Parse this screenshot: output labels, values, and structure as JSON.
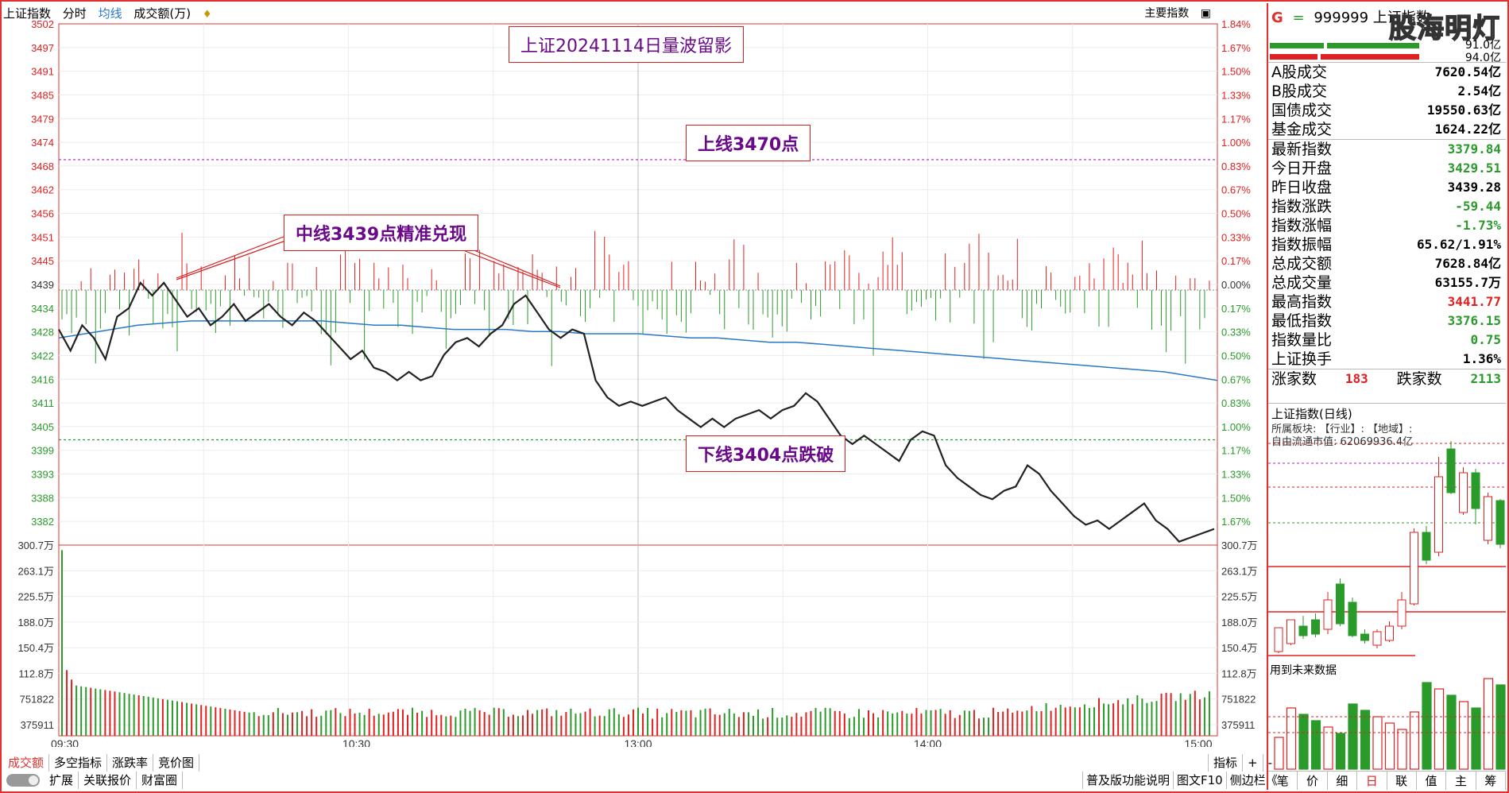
{
  "colors": {
    "up": "#e02020",
    "down": "#2a9a2a",
    "avg_line": "#2878c8",
    "index_line": "#222222",
    "frame": "#e03030",
    "annotation_text": "#6a0a8a"
  },
  "topbar": {
    "index_name": "上证指数",
    "tab_timeshare": "分时",
    "tab_avg": "均线",
    "tab_amount": "成交额(万)",
    "amount_icon": "♦",
    "main_indicator": "主要指数",
    "main_indicator_icon": "▣"
  },
  "annotations": {
    "title": "上证20241114日量波留影",
    "upper": "上线3470点",
    "middle": "中线3439点精准兑现",
    "lower": "下线3404点跌破"
  },
  "axes": {
    "price_left": [
      "3502",
      "3497",
      "3491",
      "3485",
      "3479",
      "3474",
      "3468",
      "3462",
      "3456",
      "3451",
      "3445",
      "3439",
      "3434",
      "3428",
      "3422",
      "3416",
      "3411",
      "3405",
      "3399",
      "3393",
      "3388",
      "3382"
    ],
    "pct_right": [
      "1.84%",
      "1.67%",
      "1.50%",
      "1.33%",
      "1.17%",
      "1.00%",
      "0.83%",
      "0.67%",
      "0.50%",
      "0.33%",
      "0.17%",
      "0.00%",
      "0.17%",
      "0.33%",
      "0.50%",
      "0.67%",
      "0.83%",
      "1.00%",
      "1.17%",
      "1.33%",
      "1.50%",
      "1.67%"
    ],
    "volume_labels": [
      "300.7万",
      "263.1万",
      "225.5万",
      "188.0万",
      "150.4万",
      "112.8万",
      "751822",
      "375911"
    ],
    "time_labels": [
      "09:30",
      "10:30",
      "13:00",
      "14:00",
      "15:00"
    ]
  },
  "chart_data": {
    "type": "line",
    "title": "",
    "xlabel": "",
    "ylabel": "",
    "prev_close": 3439.28,
    "ylim": [
      3379.2,
      3502
    ],
    "upper_line": 3470,
    "lower_line": 3404,
    "index_series": [
      3430,
      3425,
      3431,
      3428,
      3423,
      3433,
      3435,
      3441,
      3438,
      3441,
      3437,
      3433,
      3435,
      3431,
      3433,
      3436,
      3432,
      3434,
      3436,
      3433,
      3431,
      3434,
      3432,
      3429,
      3426,
      3423,
      3425,
      3421,
      3420,
      3418,
      3420,
      3418,
      3419,
      3424,
      3427,
      3428,
      3426,
      3429,
      3431,
      3436,
      3438,
      3434,
      3430,
      3428,
      3430,
      3429,
      3418,
      3414,
      3412,
      3413,
      3412,
      3413,
      3414,
      3411,
      3409,
      3407,
      3409,
      3407,
      3409,
      3410,
      3411,
      3409,
      3411,
      3412,
      3415,
      3413,
      3409,
      3405,
      3403,
      3405,
      3403,
      3401,
      3399,
      3404,
      3406,
      3405,
      3398,
      3395,
      3393,
      3391,
      3390,
      3392,
      3393,
      3398,
      3396,
      3392,
      3389,
      3386,
      3384,
      3385,
      3383,
      3385,
      3387,
      3389,
      3385,
      3383,
      3380,
      3381,
      3382,
      3383
    ],
    "avg_series": [
      3428,
      3429,
      3430,
      3431,
      3431.5,
      3432,
      3432,
      3432,
      3432,
      3432,
      3432,
      3431.5,
      3431,
      3431,
      3430.5,
      3430,
      3430,
      3430,
      3429.5,
      3429.5,
      3429,
      3429,
      3429,
      3428.5,
      3428,
      3428,
      3427.5,
      3427,
      3427,
      3426.5,
      3426,
      3425.5,
      3425,
      3424.5,
      3424,
      3423.5,
      3423,
      3422.5,
      3422,
      3421.5,
      3421,
      3420.5,
      3420,
      3419,
      3418
    ],
    "volume_max": 3007000
  },
  "right_panel": {
    "g_label": "G",
    "eq_label": "=",
    "code": "999999",
    "name": "上证指数",
    "watermark": "股海明灯",
    "amt_top": "91.0亿",
    "amt_bottom": "94.0亿",
    "rows_a": [
      {
        "label": "A股成交",
        "value": "7620.54亿"
      },
      {
        "label": "B股成交",
        "value": "2.54亿"
      },
      {
        "label": "国债成交",
        "value": "19550.63亿"
      },
      {
        "label": "基金成交",
        "value": "1624.22亿"
      }
    ],
    "rows_b": [
      {
        "label": "最新指数",
        "value": "3379.84",
        "cls": "green"
      },
      {
        "label": "今日开盘",
        "value": "3429.51",
        "cls": "green"
      },
      {
        "label": "昨日收盘",
        "value": "3439.28",
        "cls": ""
      },
      {
        "label": "指数涨跌",
        "value": "-59.44",
        "cls": "green"
      },
      {
        "label": "指数涨幅",
        "value": "-1.73%",
        "cls": "green"
      },
      {
        "label": "指数振幅",
        "value": "65.62/1.91%",
        "cls": ""
      },
      {
        "label": "总成交额",
        "value": "7628.84亿",
        "cls": ""
      },
      {
        "label": "总成交量",
        "value": "63155.7万",
        "cls": ""
      },
      {
        "label": "最高指数",
        "value": "3441.77",
        "cls": "red"
      },
      {
        "label": "最低指数",
        "value": "3376.15",
        "cls": "green"
      },
      {
        "label": "指数量比",
        "value": "0.75",
        "cls": "green"
      },
      {
        "label": "上证换手",
        "value": "1.36%",
        "cls": ""
      }
    ],
    "up_label": "涨家数",
    "up_count": "183",
    "down_label": "跌家数",
    "down_count": "2113",
    "daily_title": "上证指数(日线)",
    "daily_info1": "所属板块: 【行业】: 【地域】:",
    "daily_info2": "自由流通市值: 62069936.4亿",
    "future_label": "用到未来数据",
    "bottom_tabs": [
      "笔",
      "价",
      "细",
      "日",
      "联",
      "值",
      "主",
      "筹"
    ]
  },
  "bottom": {
    "tabs1": [
      "成交额",
      "多空指标",
      "涨跌率",
      "竞价图"
    ],
    "tabs1_right": [
      "指标",
      "+",
      "-"
    ],
    "tabs2": [
      "扩展",
      "关联报价",
      "财富圈"
    ],
    "tabs2_right": [
      "普及版功能说明",
      "图文F10",
      "侧边栏《"
    ]
  }
}
